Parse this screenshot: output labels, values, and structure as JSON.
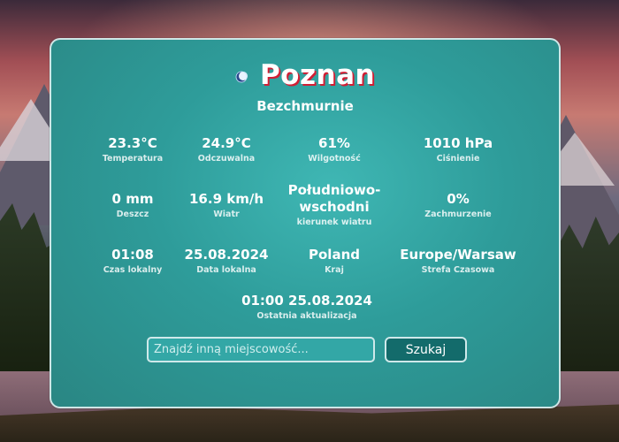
{
  "header": {
    "icon": "moon-icon",
    "city": "Poznan",
    "condition": "Bezchmurnie"
  },
  "stats": [
    {
      "value": "23.3°C",
      "label": "Temperatura"
    },
    {
      "value": "24.9°C",
      "label": "Odczuwalna"
    },
    {
      "value": "61%",
      "label": "Wilgotność"
    },
    {
      "value": "1010 hPa",
      "label": "Ciśnienie"
    },
    {
      "value": "0 mm",
      "label": "Deszcz"
    },
    {
      "value": "16.9 km/h",
      "label": "Wiatr"
    },
    {
      "value": "Południowo-",
      "value2": "wschodni",
      "label": "kierunek wiatru"
    },
    {
      "value": "0%",
      "label": "Zachmurzenie"
    },
    {
      "value": "01:08",
      "label": "Czas lokalny"
    },
    {
      "value": "25.08.2024",
      "label": "Data lokalna"
    },
    {
      "value": "Poland",
      "label": "Kraj"
    },
    {
      "value": "Europe/Warsaw",
      "label": "Strefa Czasowa"
    },
    {
      "value": "01:00 25.08.2024",
      "label": "Ostatnia aktualizacja"
    }
  ],
  "search": {
    "placeholder": "Znajdź inną miejscowość...",
    "button_label": "Szukaj"
  },
  "colors": {
    "card": "#2e9c9a",
    "button": "#136b6b",
    "city_shadow": "#d11e34"
  }
}
